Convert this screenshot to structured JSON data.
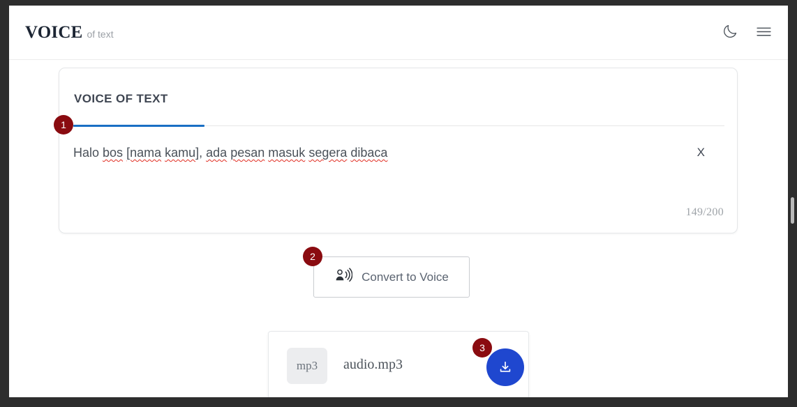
{
  "brand": {
    "main": "VOICE",
    "sub": "of text"
  },
  "nav": {
    "dark_mode_icon": "moon-icon",
    "menu_icon": "hamburger-menu-icon"
  },
  "card": {
    "title": "VOICE OF TEXT",
    "text_value": "Halo bos [nama kamu], ada pesan masuk segera dibaca",
    "text_segments": [
      {
        "text": "Halo ",
        "misspelled": false
      },
      {
        "text": "bos",
        "misspelled": true
      },
      {
        "text": " ",
        "misspelled": false
      },
      {
        "text": "[nama",
        "misspelled": true
      },
      {
        "text": " ",
        "misspelled": false
      },
      {
        "text": "kamu",
        "misspelled": true
      },
      {
        "text": "], ",
        "misspelled": false
      },
      {
        "text": "ada",
        "misspelled": true
      },
      {
        "text": " ",
        "misspelled": false
      },
      {
        "text": "pesan",
        "misspelled": true
      },
      {
        "text": " ",
        "misspelled": false
      },
      {
        "text": "masuk",
        "misspelled": true
      },
      {
        "text": " ",
        "misspelled": false
      },
      {
        "text": "segera",
        "misspelled": true
      },
      {
        "text": " ",
        "misspelled": false
      },
      {
        "text": "dibaca",
        "misspelled": true
      }
    ],
    "clear_label": "X",
    "char_counter": "149/200"
  },
  "convert": {
    "label": "Convert to Voice",
    "icon": "person-speaking-icon"
  },
  "download": {
    "file_type": "mp3",
    "filename": "audio.mp3",
    "button_icon": "download-icon"
  },
  "badges": {
    "one": "1",
    "two": "2",
    "three": "3"
  },
  "colors": {
    "accent_blue": "#1a6fc4",
    "download_blue": "#1f47cf",
    "badge_red": "#8a0b10",
    "spellcheck_red": "#e02b20",
    "brand_navy": "#1c2533"
  }
}
